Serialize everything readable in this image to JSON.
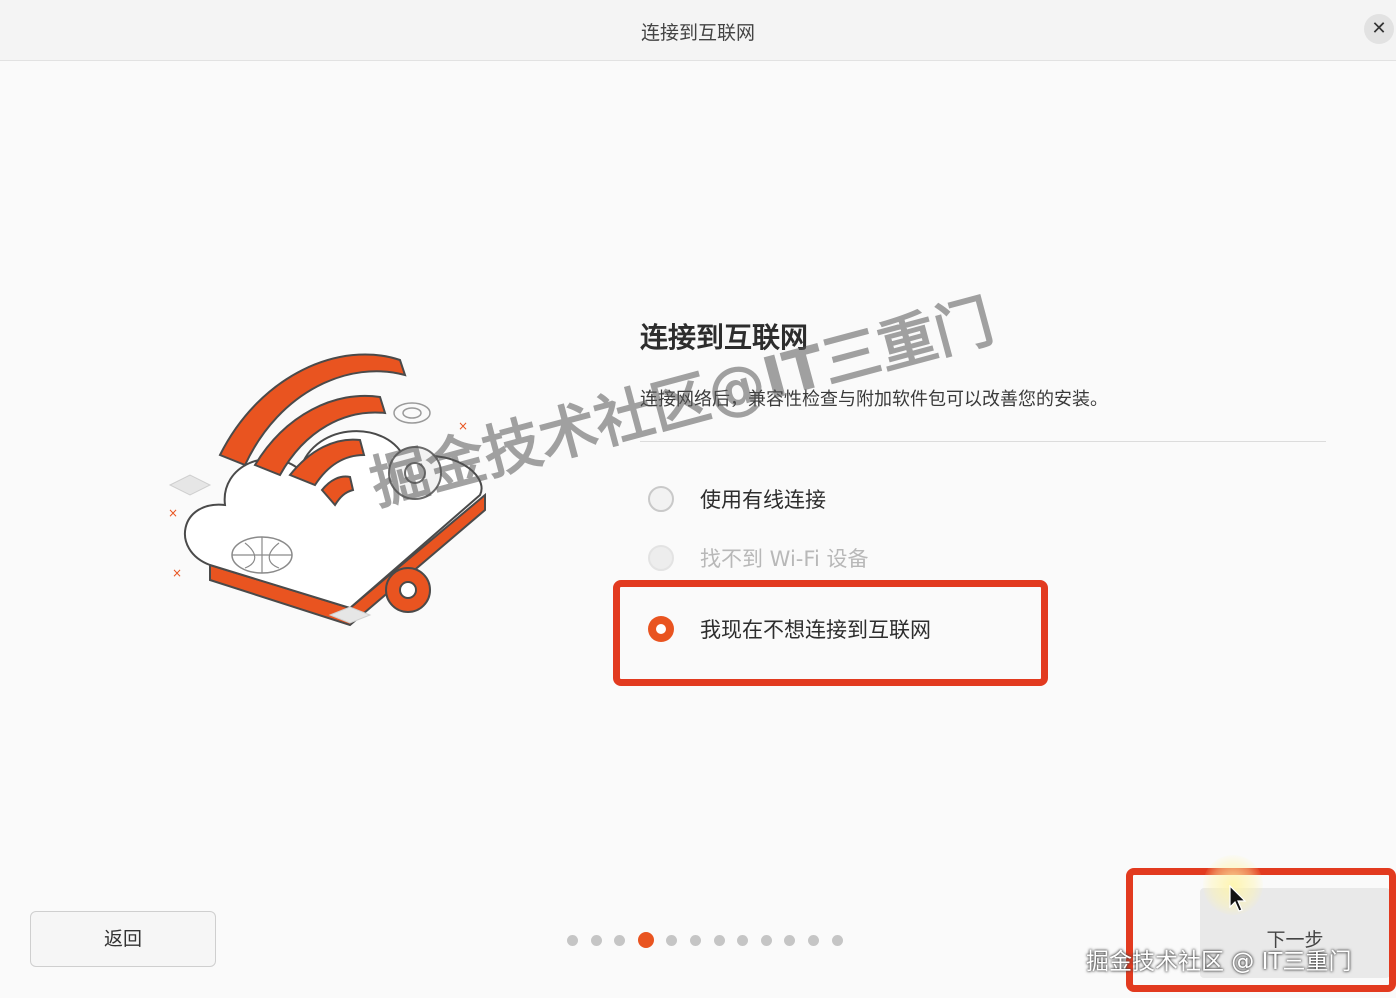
{
  "window": {
    "title": "连接到互联网",
    "close_icon": "close-icon"
  },
  "main": {
    "heading": "连接到互联网",
    "description": "连接网络后，兼容性检查与附加软件包可以改善您的安装。",
    "options": [
      {
        "label": "使用有线连接",
        "state": "unselected"
      },
      {
        "label": "找不到 Wi-Fi 设备",
        "state": "disabled"
      },
      {
        "label": "我现在不想连接到互联网",
        "state": "selected"
      }
    ]
  },
  "footer": {
    "back_label": "返回",
    "next_label": "下一步",
    "progress": {
      "total_steps": 12,
      "current_step": 4
    }
  },
  "watermarks": {
    "center": "掘金技术社区@IT三重门",
    "corner": "掘金技术社区 @ IT三重门"
  },
  "colors": {
    "accent": "#e95420",
    "annotation_red": "#e23a1f"
  }
}
